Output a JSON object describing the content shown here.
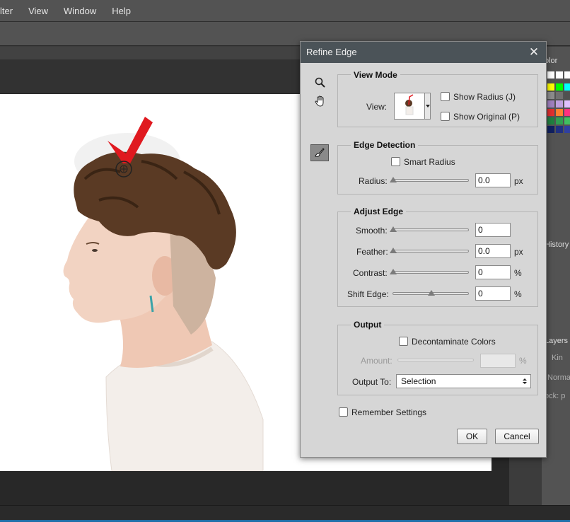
{
  "menubar": {
    "items": [
      "lter",
      "View",
      "Window",
      "Help"
    ]
  },
  "right_panel": {
    "color_label": "olor",
    "history_label": "History",
    "layers_label": "Layers",
    "kind_label": "Kin",
    "normal_label": "Norma",
    "lock_label": "ock: p"
  },
  "dialog": {
    "title": "Refine Edge",
    "close_glyph": "✕",
    "view_mode": {
      "title": "View Mode",
      "view_label": "View:",
      "show_radius": "Show Radius (J)",
      "show_original": "Show Original (P)"
    },
    "edge_detection": {
      "title": "Edge Detection",
      "smart_radius": "Smart Radius",
      "radius_label": "Radius:",
      "radius_value": "0.0",
      "radius_unit": "px",
      "radius_slider": 0
    },
    "adjust_edge": {
      "title": "Adjust Edge",
      "rows": [
        {
          "label": "Smooth:",
          "value": "0",
          "unit": "",
          "slider": 0
        },
        {
          "label": "Feather:",
          "value": "0.0",
          "unit": "px",
          "slider": 0
        },
        {
          "label": "Contrast:",
          "value": "0",
          "unit": "%",
          "slider": 0
        },
        {
          "label": "Shift Edge:",
          "value": "0",
          "unit": "%",
          "slider": 0.5
        }
      ]
    },
    "output": {
      "title": "Output",
      "decontaminate": "Decontaminate Colors",
      "amount_label": "Amount:",
      "amount_value": "",
      "amount_unit": "%",
      "output_to_label": "Output To:",
      "output_to_value": "Selection"
    },
    "remember_settings": "Remember Settings",
    "ok_label": "OK",
    "cancel_label": "Cancel"
  },
  "colors": {
    "checkmark": "#e0191f",
    "hair": "#5a3a24",
    "skin": "#f2d3c2",
    "sweater": "#f3eeea"
  }
}
